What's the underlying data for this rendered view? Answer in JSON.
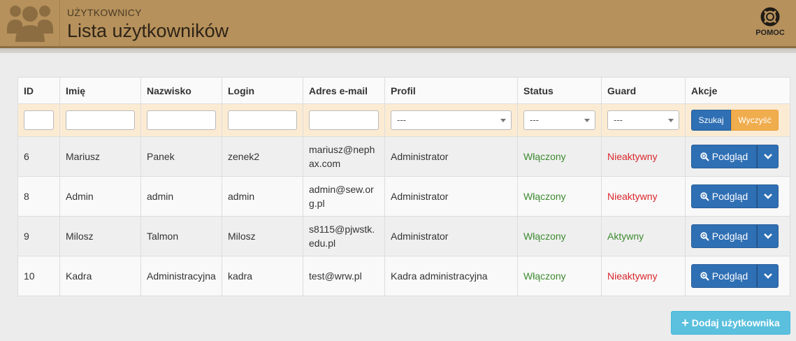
{
  "header": {
    "section": "UŻYTKOWNICY",
    "title": "Lista użytkowników",
    "help_label": "POMOC"
  },
  "table": {
    "columns": [
      "ID",
      "Imię",
      "Nazwisko",
      "Login",
      "Adres e-mail",
      "Profil",
      "Status",
      "Guard",
      "Akcje"
    ],
    "filters": {
      "profile": "---",
      "status": "---",
      "guard": "---",
      "search_label": "Szukaj",
      "clear_label": "Wyczyść"
    },
    "rows": [
      {
        "id": "6",
        "name": "Mariusz",
        "surname": "Panek",
        "login": "zenek2",
        "email": "mariusz@nephax.com",
        "profile": "Administrator",
        "status": "Włączony",
        "guard": "Nieaktywny"
      },
      {
        "id": "8",
        "name": "Admin",
        "surname": "admin",
        "login": "admin",
        "email": "admin@sew.org.pl",
        "profile": "Administrator",
        "status": "Włączony",
        "guard": "Nieaktywny"
      },
      {
        "id": "9",
        "name": "Milosz",
        "surname": "Talmon",
        "login": "Milosz",
        "email": "s8115@pjwstk.edu.pl",
        "profile": "Administrator",
        "status": "Włączony",
        "guard": "Aktywny"
      },
      {
        "id": "10",
        "name": "Kadra",
        "surname": "Administracyjna",
        "login": "kadra",
        "email": "test@wrw.pl",
        "profile": "Kadra administracyjna",
        "status": "Włączony",
        "guard": "Nieaktywny"
      }
    ],
    "view_label": "Podgląd"
  },
  "add_user_label": "Dodaj użytkownika",
  "colors": {
    "header_bg": "#b6915c",
    "primary": "#2f6fb4",
    "warning": "#f0ad4e",
    "info": "#5bc0de",
    "success_text": "#3c8a2e",
    "danger_text": "#d9262b"
  },
  "icons": {
    "logo": "users-icon",
    "help": "life-ring-icon",
    "view": "zoom-in-icon",
    "dropdown": "chevron-down-icon",
    "add": "plus-icon"
  }
}
